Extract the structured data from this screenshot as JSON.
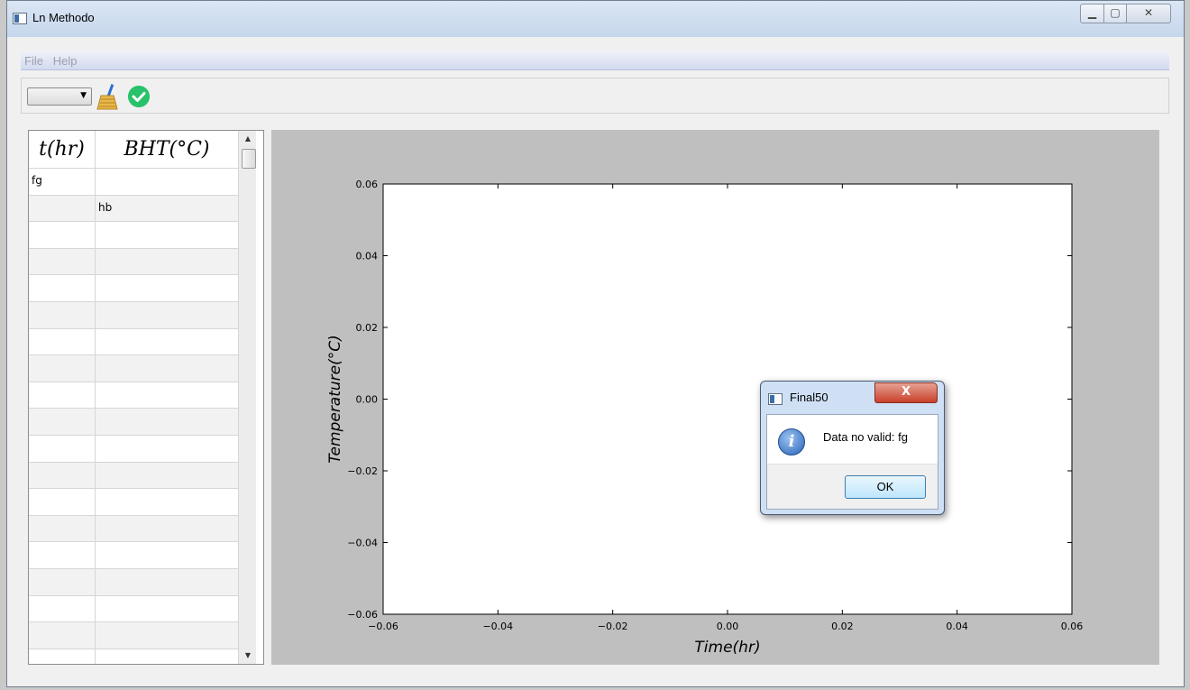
{
  "window": {
    "title": "Ln Methodo"
  },
  "menu": {
    "items": [
      "File",
      "Help"
    ]
  },
  "toolbar": {
    "combo_value": "",
    "broom_icon": "broom-icon",
    "check_icon": "check-icon"
  },
  "table": {
    "headers": [
      "t(hr)",
      "BHT(°C)"
    ],
    "rows": [
      [
        "fg",
        ""
      ],
      [
        "",
        "hb"
      ],
      [
        "",
        ""
      ],
      [
        "",
        ""
      ],
      [
        "",
        ""
      ],
      [
        "",
        ""
      ],
      [
        "",
        ""
      ],
      [
        "",
        ""
      ],
      [
        "",
        ""
      ],
      [
        "",
        ""
      ],
      [
        "",
        ""
      ],
      [
        "",
        ""
      ],
      [
        "",
        ""
      ],
      [
        "",
        ""
      ],
      [
        "",
        ""
      ],
      [
        "",
        ""
      ],
      [
        "",
        ""
      ],
      [
        "",
        ""
      ],
      [
        "",
        ""
      ]
    ]
  },
  "chart_data": {
    "type": "scatter",
    "title": "",
    "xlabel": "Time(hr)",
    "ylabel": "Temperature(°C)",
    "xlim": [
      -0.06,
      0.06
    ],
    "ylim": [
      -0.06,
      0.06
    ],
    "x_ticks": [
      "−0.06",
      "−0.04",
      "−0.02",
      "0.00",
      "0.02",
      "0.04",
      "0.06"
    ],
    "y_ticks": [
      "0.06",
      "0.04",
      "0.02",
      "0.00",
      "−0.02",
      "−0.04",
      "−0.06"
    ],
    "series": [],
    "grid": false
  },
  "dialog": {
    "title": "Final50",
    "close_label": "X",
    "message": "Data no valid: fg",
    "ok_label": "OK",
    "icon": "info-icon"
  }
}
